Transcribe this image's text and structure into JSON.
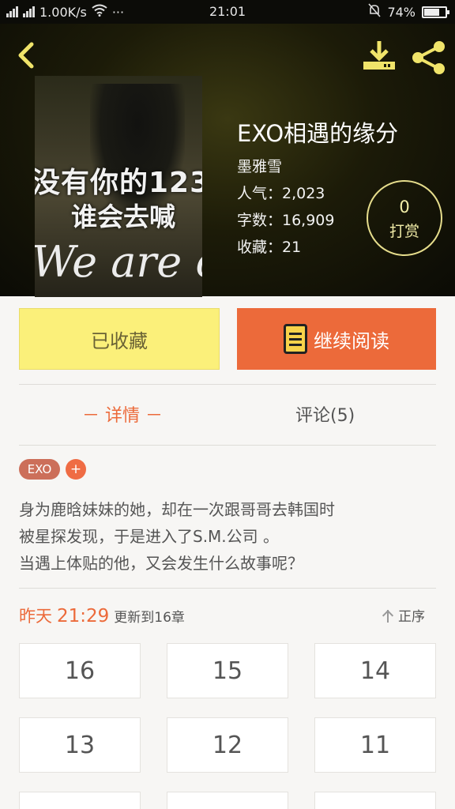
{
  "status_bar": {
    "network": "4G",
    "network2": "2G",
    "speed": "1.00K/s",
    "dots": "···",
    "time": "21:01",
    "battery": "74%",
    "battery_level": 0.74
  },
  "book": {
    "title": "EXO相遇的缘分",
    "author": "墨雅雪",
    "popularity": "人气：2,023",
    "word_count": "字数：16,909",
    "favorites": "收藏：21",
    "cover_text": [
      "没有你的123",
      "谁会去喊",
      "We are o"
    ]
  },
  "tip": {
    "count": "0",
    "label": "打赏"
  },
  "actions": {
    "favorited_label": "已收藏",
    "continue_label": "继续阅读"
  },
  "tabs": {
    "detail": "－ 详情 －",
    "comments": "评论(5)"
  },
  "tags": {
    "primary": "EXO",
    "add": "+"
  },
  "description": [
    "身为鹿晗妹妹的她，却在一次跟哥哥去韩国时",
    "被星探发现，于是进入了S.M.公司 。",
    "当遇上体贴的他，又会发生什么故事呢？"
  ],
  "update": {
    "day": "昨天",
    "time": "21:29",
    "text": "更新到16章",
    "order_label": "正序"
  },
  "chapters": [
    "16",
    "15",
    "14",
    "13",
    "12",
    "11"
  ]
}
